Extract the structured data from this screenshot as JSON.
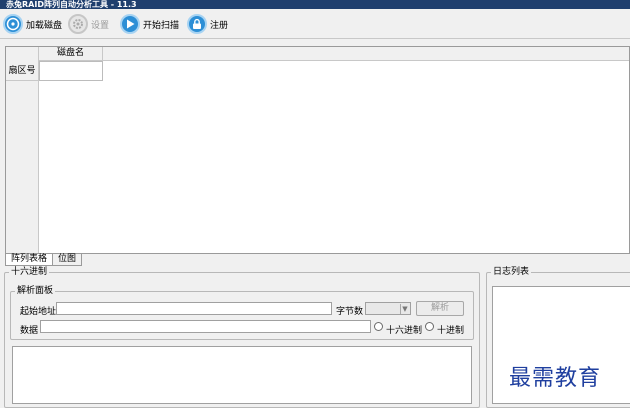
{
  "window": {
    "title": "赤兔RAID阵列自动分析工具 - 11.3"
  },
  "toolbar": {
    "load_disk": {
      "label": "加载磁盘",
      "icon": "disk-plus-icon"
    },
    "settings": {
      "label": "设置",
      "icon": "gear-icon",
      "enabled": false
    },
    "start_scan": {
      "label": "开始扫描",
      "icon": "play-icon"
    },
    "register": {
      "label": "注册",
      "icon": "lock-icon"
    }
  },
  "grid": {
    "column_header": "磁盘名",
    "row_header": "扇区号"
  },
  "tabs": [
    {
      "label": "阵列表格",
      "active": true
    },
    {
      "label": "位图",
      "active": false
    }
  ],
  "hex_panel": {
    "title": "十六进制",
    "parse_panel": {
      "title": "解析面板",
      "start_address_label": "起始地址",
      "start_address_value": "",
      "byte_count_label": "字节数",
      "byte_count_value": "",
      "parse_button": "解析",
      "data_label": "数据",
      "data_value": "",
      "radio_hex_label": "十六进制",
      "radio_dec_label": "十进制"
    }
  },
  "log_panel": {
    "title": "日志列表"
  },
  "watermark": "最需教育",
  "colors": {
    "title_bar": "#1f3f6e",
    "toolbar_icon_blue": "#2d8fd6",
    "watermark": "#1f3f9f"
  }
}
